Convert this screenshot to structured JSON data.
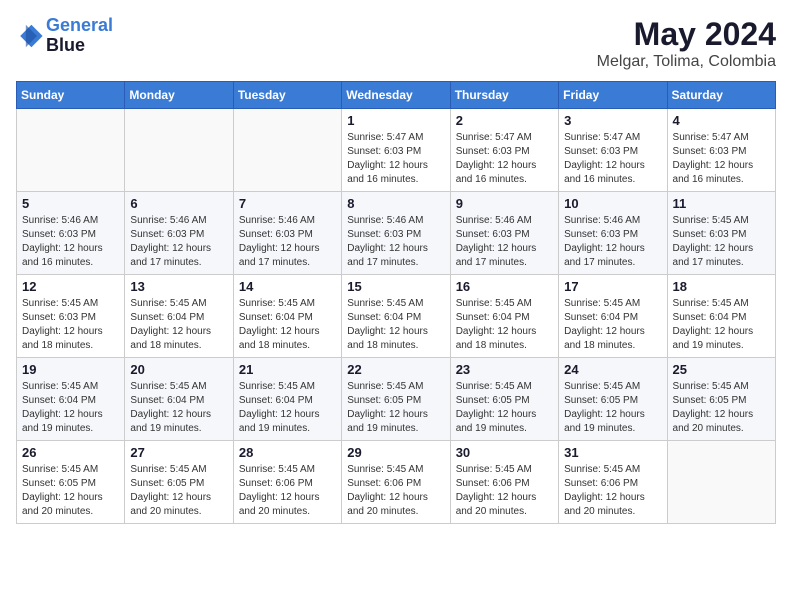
{
  "header": {
    "logo_line1": "General",
    "logo_line2": "Blue",
    "month_year": "May 2024",
    "location": "Melgar, Tolima, Colombia"
  },
  "days_of_week": [
    "Sunday",
    "Monday",
    "Tuesday",
    "Wednesday",
    "Thursday",
    "Friday",
    "Saturday"
  ],
  "weeks": [
    [
      {
        "number": "",
        "detail": ""
      },
      {
        "number": "",
        "detail": ""
      },
      {
        "number": "",
        "detail": ""
      },
      {
        "number": "1",
        "detail": "Sunrise: 5:47 AM\nSunset: 6:03 PM\nDaylight: 12 hours\nand 16 minutes."
      },
      {
        "number": "2",
        "detail": "Sunrise: 5:47 AM\nSunset: 6:03 PM\nDaylight: 12 hours\nand 16 minutes."
      },
      {
        "number": "3",
        "detail": "Sunrise: 5:47 AM\nSunset: 6:03 PM\nDaylight: 12 hours\nand 16 minutes."
      },
      {
        "number": "4",
        "detail": "Sunrise: 5:47 AM\nSunset: 6:03 PM\nDaylight: 12 hours\nand 16 minutes."
      }
    ],
    [
      {
        "number": "5",
        "detail": "Sunrise: 5:46 AM\nSunset: 6:03 PM\nDaylight: 12 hours\nand 16 minutes."
      },
      {
        "number": "6",
        "detail": "Sunrise: 5:46 AM\nSunset: 6:03 PM\nDaylight: 12 hours\nand 17 minutes."
      },
      {
        "number": "7",
        "detail": "Sunrise: 5:46 AM\nSunset: 6:03 PM\nDaylight: 12 hours\nand 17 minutes."
      },
      {
        "number": "8",
        "detail": "Sunrise: 5:46 AM\nSunset: 6:03 PM\nDaylight: 12 hours\nand 17 minutes."
      },
      {
        "number": "9",
        "detail": "Sunrise: 5:46 AM\nSunset: 6:03 PM\nDaylight: 12 hours\nand 17 minutes."
      },
      {
        "number": "10",
        "detail": "Sunrise: 5:46 AM\nSunset: 6:03 PM\nDaylight: 12 hours\nand 17 minutes."
      },
      {
        "number": "11",
        "detail": "Sunrise: 5:45 AM\nSunset: 6:03 PM\nDaylight: 12 hours\nand 17 minutes."
      }
    ],
    [
      {
        "number": "12",
        "detail": "Sunrise: 5:45 AM\nSunset: 6:03 PM\nDaylight: 12 hours\nand 18 minutes."
      },
      {
        "number": "13",
        "detail": "Sunrise: 5:45 AM\nSunset: 6:04 PM\nDaylight: 12 hours\nand 18 minutes."
      },
      {
        "number": "14",
        "detail": "Sunrise: 5:45 AM\nSunset: 6:04 PM\nDaylight: 12 hours\nand 18 minutes."
      },
      {
        "number": "15",
        "detail": "Sunrise: 5:45 AM\nSunset: 6:04 PM\nDaylight: 12 hours\nand 18 minutes."
      },
      {
        "number": "16",
        "detail": "Sunrise: 5:45 AM\nSunset: 6:04 PM\nDaylight: 12 hours\nand 18 minutes."
      },
      {
        "number": "17",
        "detail": "Sunrise: 5:45 AM\nSunset: 6:04 PM\nDaylight: 12 hours\nand 18 minutes."
      },
      {
        "number": "18",
        "detail": "Sunrise: 5:45 AM\nSunset: 6:04 PM\nDaylight: 12 hours\nand 19 minutes."
      }
    ],
    [
      {
        "number": "19",
        "detail": "Sunrise: 5:45 AM\nSunset: 6:04 PM\nDaylight: 12 hours\nand 19 minutes."
      },
      {
        "number": "20",
        "detail": "Sunrise: 5:45 AM\nSunset: 6:04 PM\nDaylight: 12 hours\nand 19 minutes."
      },
      {
        "number": "21",
        "detail": "Sunrise: 5:45 AM\nSunset: 6:04 PM\nDaylight: 12 hours\nand 19 minutes."
      },
      {
        "number": "22",
        "detail": "Sunrise: 5:45 AM\nSunset: 6:05 PM\nDaylight: 12 hours\nand 19 minutes."
      },
      {
        "number": "23",
        "detail": "Sunrise: 5:45 AM\nSunset: 6:05 PM\nDaylight: 12 hours\nand 19 minutes."
      },
      {
        "number": "24",
        "detail": "Sunrise: 5:45 AM\nSunset: 6:05 PM\nDaylight: 12 hours\nand 19 minutes."
      },
      {
        "number": "25",
        "detail": "Sunrise: 5:45 AM\nSunset: 6:05 PM\nDaylight: 12 hours\nand 20 minutes."
      }
    ],
    [
      {
        "number": "26",
        "detail": "Sunrise: 5:45 AM\nSunset: 6:05 PM\nDaylight: 12 hours\nand 20 minutes."
      },
      {
        "number": "27",
        "detail": "Sunrise: 5:45 AM\nSunset: 6:05 PM\nDaylight: 12 hours\nand 20 minutes."
      },
      {
        "number": "28",
        "detail": "Sunrise: 5:45 AM\nSunset: 6:06 PM\nDaylight: 12 hours\nand 20 minutes."
      },
      {
        "number": "29",
        "detail": "Sunrise: 5:45 AM\nSunset: 6:06 PM\nDaylight: 12 hours\nand 20 minutes."
      },
      {
        "number": "30",
        "detail": "Sunrise: 5:45 AM\nSunset: 6:06 PM\nDaylight: 12 hours\nand 20 minutes."
      },
      {
        "number": "31",
        "detail": "Sunrise: 5:45 AM\nSunset: 6:06 PM\nDaylight: 12 hours\nand 20 minutes."
      },
      {
        "number": "",
        "detail": ""
      }
    ]
  ]
}
